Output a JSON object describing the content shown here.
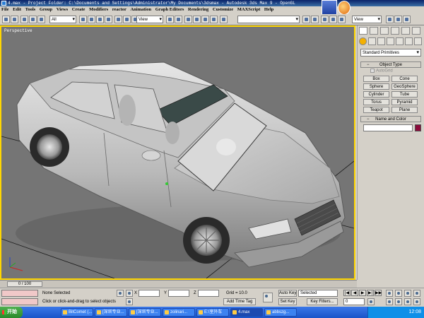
{
  "title": "4.max - Project Folder: C:\\Documents and Settings\\Administrator\\My Documents\\3dsmax - Autodesk 3ds Max 9 - OpenGL",
  "menu": [
    "File",
    "Edit",
    "Tools",
    "Group",
    "Views",
    "Create",
    "Modifiers",
    "reactor",
    "Animation",
    "Graph Editors",
    "Rendering",
    "Customize",
    "MAXScript",
    "Help"
  ],
  "toolbar": {
    "selection_filter": "All",
    "reference_coord": "View",
    "right_view": "View"
  },
  "viewport": {
    "label": "Perspective"
  },
  "command_panel": {
    "category": "Standard Primitives",
    "object_type_title": "Object Type",
    "autogrid": "AutoGrid",
    "primitives": [
      "Box",
      "Cone",
      "Sphere",
      "GeoSphere",
      "Cylinder",
      "Tube",
      "Torus",
      "Pyramid",
      "Teapot",
      "Plane"
    ],
    "name_color_title": "Name and Color",
    "object_color": "#8b0a3a"
  },
  "time_slider": {
    "position": "0 / 100"
  },
  "status": {
    "selection": "None Selected",
    "prompt": "Click or click-and-drag to select objects",
    "x_label": "X",
    "y_label": "Y",
    "z_label": "Z",
    "grid": "Grid = 10.0",
    "add_time_tag": "Add Time Tag",
    "auto_key": "Auto Key",
    "set_key": "Set Key",
    "selected": "Selected",
    "key_filters": "Key Filters...",
    "frame": "0"
  },
  "taskbar": {
    "start": "开始",
    "tasks": [
      "BitComet (...",
      "[深圳专业...",
      "[深圳专业...",
      "zolinari...",
      "E:\\室外车",
      "4.max",
      "abbszg..."
    ],
    "clock": "12:08"
  }
}
